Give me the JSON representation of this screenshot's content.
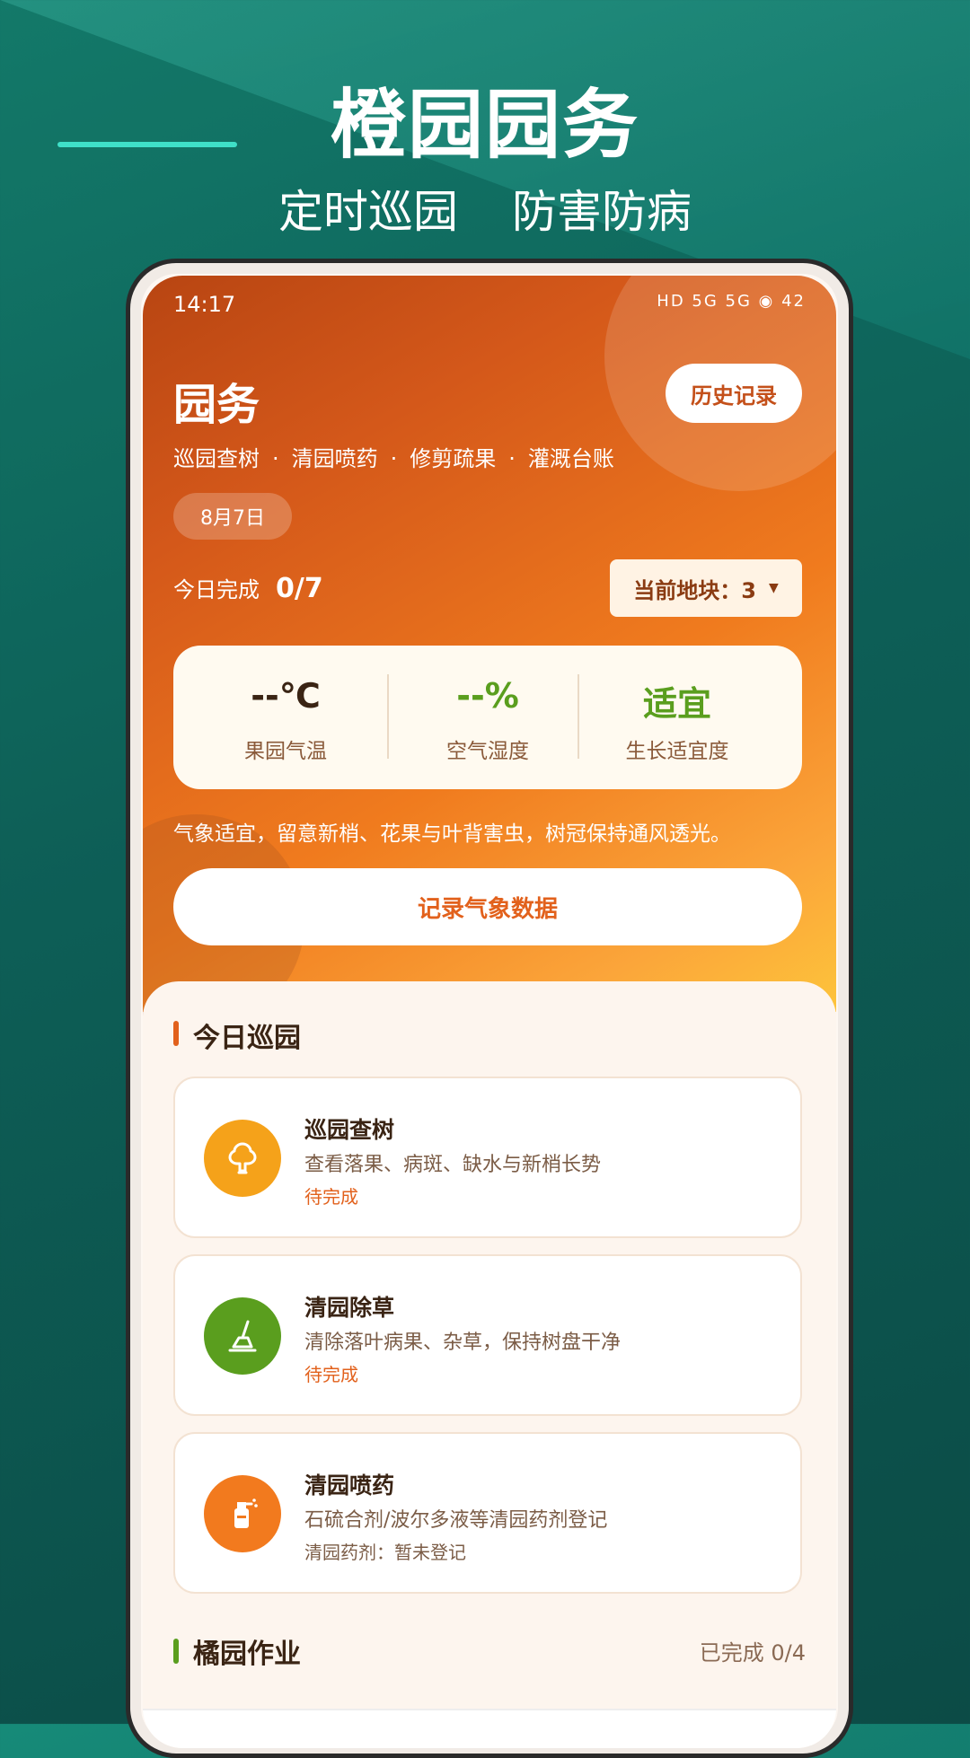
{
  "promo": {
    "title": "橙园园务",
    "sub1": "定时巡园",
    "sub2": "防害防病"
  },
  "status_bar": {
    "time": "14:17",
    "icons": "HD 5G 5G ◉ 42"
  },
  "header": {
    "title": "园务",
    "history_label": "历史记录",
    "tags": [
      "巡园查树",
      "清园喷药",
      "修剪疏果",
      "灌溉台账"
    ],
    "tag_separator": "·",
    "date": "8月7日",
    "today_done_label": "今日完成",
    "today_done_value": "0/7",
    "plot_label": "当前地块：3"
  },
  "weather": {
    "temp_value": "--℃",
    "temp_label": "果园气温",
    "humidity_value": "--%",
    "humidity_label": "空气湿度",
    "fitness_value": "适宜",
    "fitness_label": "生长适宜度",
    "colors": {
      "temp": "#3a2414",
      "humidity": "#5a9e1e",
      "fitness": "#5a9e1e"
    }
  },
  "hint": "气象适宜，留意新梢、花果与叶背害虫，树冠保持通风透光。",
  "record_button": "记录气象数据",
  "section_today": {
    "title": "今日巡园",
    "accent": "#e2611c",
    "tasks": [
      {
        "title": "巡园查树",
        "desc": "查看落果、病斑、缺水与新梢长势",
        "status": "待完成",
        "icon": "tree-icon",
        "icon_color": "#f5a21a",
        "status_color": "#e2611c"
      },
      {
        "title": "清园除草",
        "desc": "清除落叶病果、杂草，保持树盘干净",
        "status": "待完成",
        "icon": "weeding-icon",
        "icon_color": "#5a9e1e",
        "status_color": "#e2611c"
      },
      {
        "title": "清园喷药",
        "desc": "石硫合剂/波尔多液等清园药剂登记",
        "status": "清园药剂：暂未登记",
        "icon": "sprayer-icon",
        "icon_color": "#f27a1e",
        "status_color": "#7b5c46"
      }
    ]
  },
  "section_orange": {
    "title": "橘园作业",
    "accent": "#5a9e1e",
    "count": "已完成  0/4"
  }
}
